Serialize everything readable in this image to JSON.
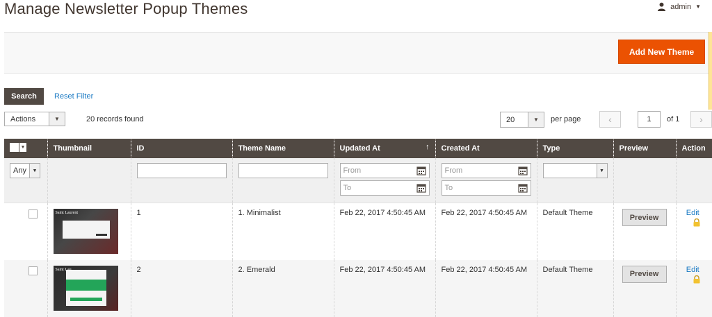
{
  "header": {
    "title": "Manage Newsletter Popup Themes",
    "user": "admin"
  },
  "actions_bar": {
    "add_label": "Add New Theme"
  },
  "toolbar": {
    "search_label": "Search",
    "reset_label": "Reset Filter",
    "actions_label": "Actions",
    "records_text": "20 records found",
    "per_page_value": "20",
    "per_page_label": "per page",
    "page_value": "1",
    "of_text": "of 1"
  },
  "columns": {
    "thumbnail": "Thumbnail",
    "id": "ID",
    "theme_name": "Theme Name",
    "updated_at": "Updated At",
    "created_at": "Created At",
    "type": "Type",
    "preview": "Preview",
    "action": "Action"
  },
  "filters": {
    "any": "Any",
    "from": "From",
    "to": "To"
  },
  "rows": [
    {
      "id": "1",
      "name": "1. Minimalist",
      "updated": "Feb 22, 2017 4:50:45 AM",
      "created": "Feb 22, 2017 4:50:45 AM",
      "type": "Default Theme",
      "preview": "Preview",
      "edit": "Edit"
    },
    {
      "id": "2",
      "name": "2. Emerald",
      "updated": "Feb 22, 2017 4:50:45 AM",
      "created": "Feb 22, 2017 4:50:45 AM",
      "type": "Default Theme",
      "preview": "Preview",
      "edit": "Edit"
    }
  ],
  "colors": {
    "accent": "#eb5202",
    "header_bg": "#514943",
    "link": "#1979c3"
  }
}
